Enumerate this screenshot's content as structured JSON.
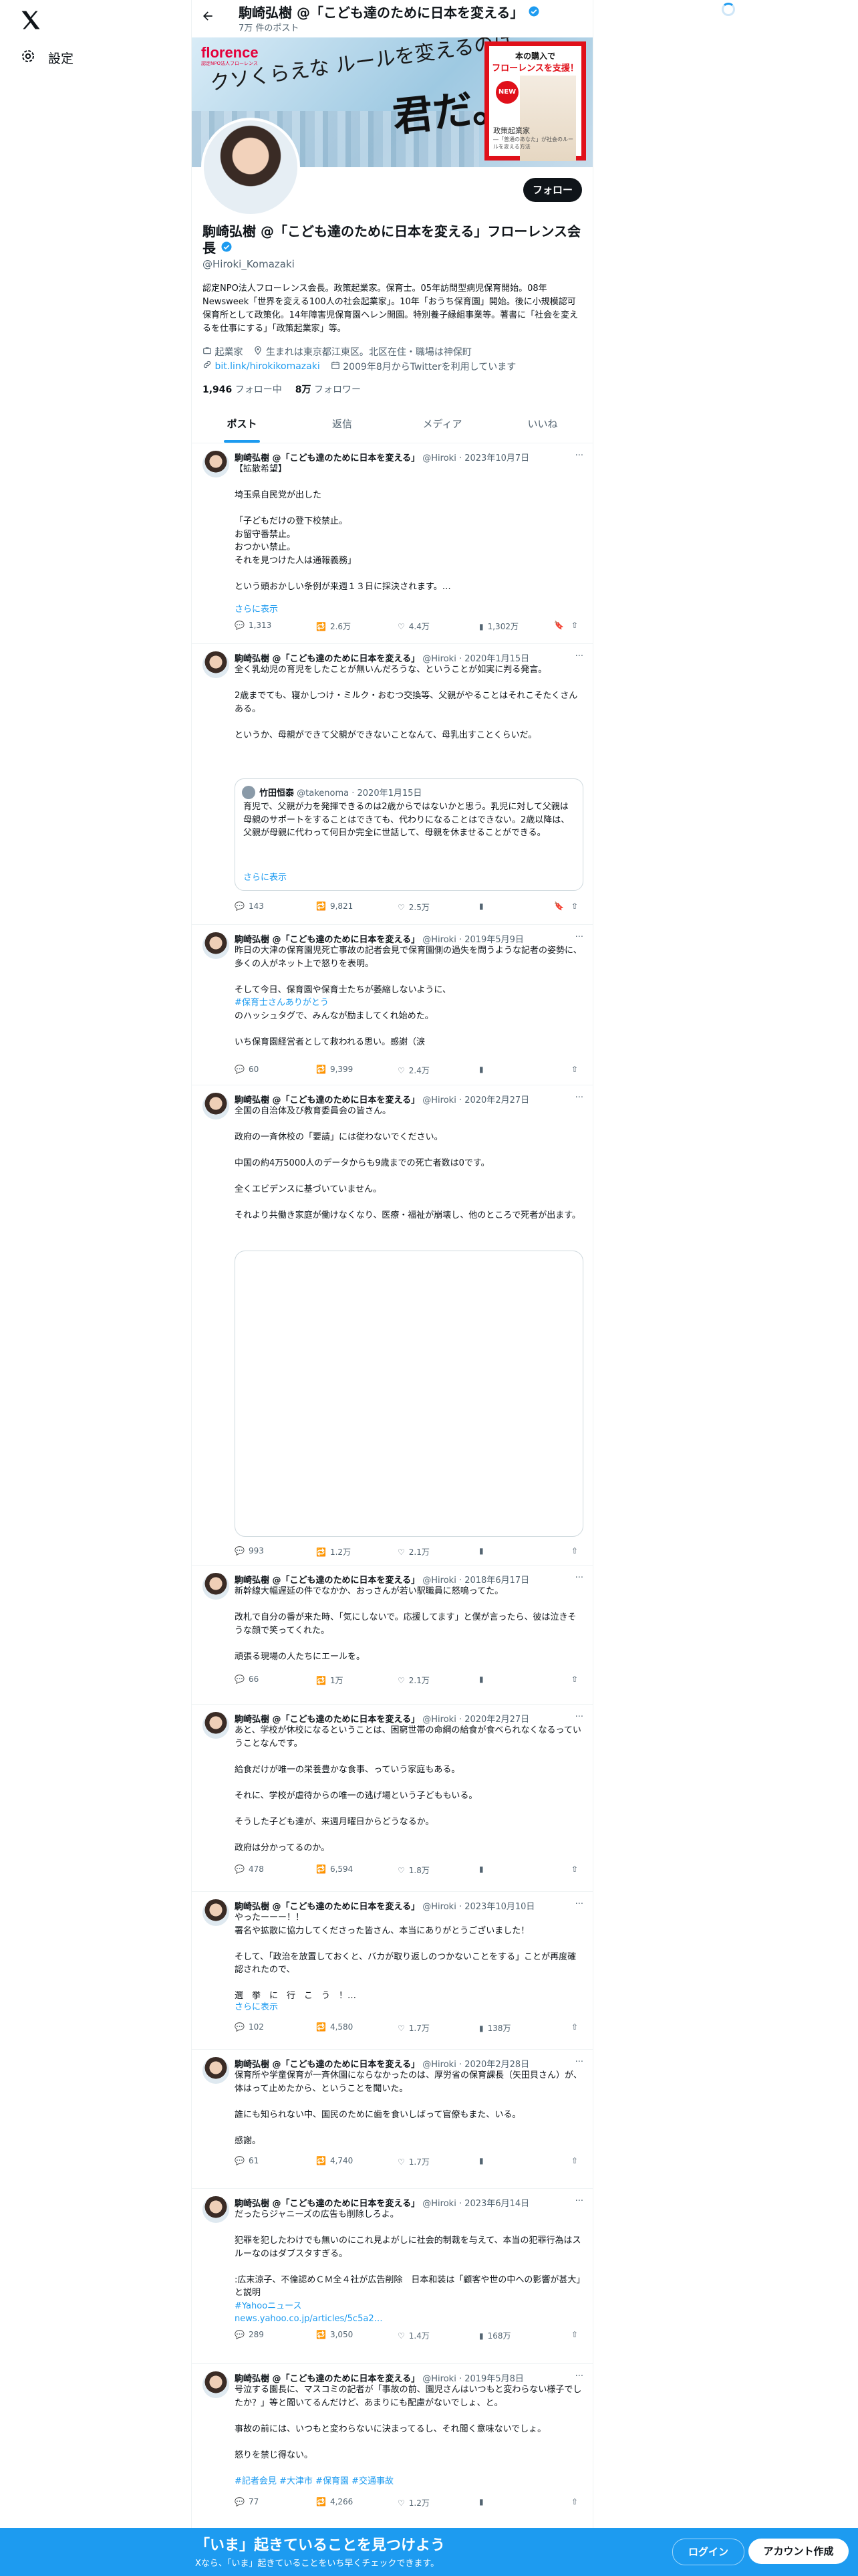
{
  "nav": {
    "settings_label": "設定"
  },
  "profile": {
    "title": "駒崎弘樹 @「こども達のために日本を変える」",
    "post_count": "7万 件のポスト",
    "follow_label": "フォロー",
    "display_name": "駒崎弘樹 @「こども達のために日本を変える」フローレンス会長",
    "handle": "@Hiroki_Komazaki",
    "bio": "認定NPO法人フローレンス会長。政策起業家。保育士。05年訪問型病児保育開始。08年Newsweek「世界を変える100人の社会起業家」。10年「おうち保育園」開始。後に小規模認可保育所として政策化。14年障害児保育園ヘレン開園。特別養子縁組事業等。著書に「社会を変えるを仕事にする」「政策起業家」等。",
    "occupation": "起業家",
    "born": "生まれは東京都江東区。北区在住・職場は神保町",
    "link": "bit.link/hirokikomazaki",
    "joined": "2009年8月からTwitterを利用しています",
    "following_count": "1,946",
    "following_label": "フォロー中",
    "followers_count": "8万",
    "followers_label": "フォロワー"
  },
  "banner": {
    "brand": "florence",
    "brand_sub": "認定NPO法人フローレンス",
    "copy": "クソくらえな ルールを変えるのは、",
    "copy_big": "君だ。",
    "ad_line1": "本の購入で",
    "ad_line2": "フローレンスを支援！",
    "ad_new": "NEW",
    "ad_book_title": "政策起業家",
    "ad_book_sub": "―「普通のあなた」が社会のルールを変える方法"
  },
  "tabs": [
    "ポスト",
    "返信",
    "メディア",
    "いいね"
  ],
  "tweets": [
    {
      "name": "駒崎弘樹 @「こども達のために日本を変える」",
      "handle": "@Hiroki",
      "date": "2023年10月7日",
      "text": "【拡散希望】\n\n埼玉県自民党が出した\n\n「子どもだけの登下校禁止。\nお留守番禁止。\nおつかい禁止。\nそれを見つけた人は通報義務」\n\nという頭おかしい条例が来週１３日に採決されます。…",
      "show_more": "さらに表示",
      "replies": "1,313",
      "reposts": "2.6万",
      "likes": "4.4万",
      "views": "1,302万"
    },
    {
      "name": "駒崎弘樹 @「こども達のために日本を変える」",
      "handle": "@Hiroki",
      "date": "2020年1月15日",
      "text": "全く乳幼児の育児をしたことが無いんだろうな、ということが如実に判る発言。\n\n2歳までても、寝かしつけ・ミルク・おむつ交換等、父親がやることはそれこそたくさんある。\n\nというか、母親ができて父親ができないことなんて、母乳出すことくらいだ。",
      "quote": {
        "name": "竹田恒泰",
        "handle": "@takenoma",
        "date": "2020年1月15日",
        "text": "育児で、父親が力を発揮できるのは2歳からではないかと思う。乳児に対して父親は母親のサポートをすることはできても、代わりになることはできない。2歳以降は、父親が母親に代わって何日か完全に世話して、母親を休ませることができる。",
        "show_more": "さらに表示"
      },
      "replies": "143",
      "reposts": "9,821",
      "likes": "2.5万"
    },
    {
      "name": "駒崎弘樹 @「こども達のために日本を変える」",
      "handle": "@Hiroki",
      "date": "2019年5月9日",
      "text": "昨日の大津の保育園児死亡事故の記者会見で保育園側の過失を問うような記者の姿勢に、多くの人がネット上で怒りを表明。\n\nそして今日、保育園や保育士たちが萎縮しないように、",
      "hashtag": "#保育士さんありがとう",
      "text_after": "のハッシュタグで、みんなが励ましてくれ始めた。\n\nいち保育園経営者として救われる思い。感謝（涙",
      "replies": "60",
      "reposts": "9,399",
      "likes": "2.4万"
    },
    {
      "name": "駒崎弘樹 @「こども達のために日本を変える」",
      "handle": "@Hiroki",
      "date": "2020年2月27日",
      "text": "全国の自治体及び教育委員会の皆さん。\n\n政府の一斉休校の「要請」には従わないでください。\n\n中国の約4万5000人のデータからも9歳までの死亡者数は0です。\n\n全くエビデンスに基づいていません。\n\nそれより共働き家庭が働けなくなり、医療・福祉が崩壊し、他のところで死者が出ます。",
      "replies": "993",
      "reposts": "1.2万",
      "likes": "2.1万"
    },
    {
      "name": "駒崎弘樹 @「こども達のために日本を変える」",
      "handle": "@Hiroki",
      "date": "2018年6月17日",
      "text": "新幹線大幅遅延の件でなかか、おっさんが若い駅職員に怒鳴ってた。\n\n改札で自分の番が来た時、「気にしないで。応援してます」と僕が言ったら、彼は泣きそうな顔で笑ってくれた。\n\n頑張る現場の人たちにエールを。",
      "replies": "66",
      "reposts": "1万",
      "likes": "2.1万"
    },
    {
      "name": "駒崎弘樹 @「こども達のために日本を変える」",
      "handle": "@Hiroki",
      "date": "2020年2月27日",
      "text": "あと、学校が休校になるということは、困窮世帯の命綱の給食が食べられなくなるっていうことなんです。\n\n給食だけが唯一の栄養豊かな食事、っていう家庭もある。\n\nそれに、学校が虐待からの唯一の逃げ場という子どももいる。\n\nそうした子ども達が、来週月曜日からどうなるか。\n\n政府は分かってるのか。",
      "replies": "478",
      "reposts": "6,594",
      "likes": "1.8万"
    },
    {
      "name": "駒崎弘樹 @「こども達のために日本を変える」",
      "handle": "@Hiroki",
      "date": "2023年10月10日",
      "text": "やったーーー！！\n署名や拡散に協力してくださった皆さん、本当にありがとうございました！\n\nそして、「政治を放置しておくと、バカが取り返しのつかないことをする」ことが再度確認されたので、\n\n選　挙　に　行　こ　う　！…",
      "show_more": "さらに表示",
      "replies": "102",
      "reposts": "4,580",
      "likes": "1.7万",
      "views": "138万"
    },
    {
      "name": "駒崎弘樹 @「こども達のために日本を変える」",
      "handle": "@Hiroki",
      "date": "2020年2月28日",
      "text": "保育所や学童保育が一斉休園にならなかったのは、厚労省の保育課長（矢田貝さん）が、体はって止めたから、ということを聞いた。\n\n誰にも知られない中、国民のために歯を食いしばって官僚もまた、いる。\n\n感謝。",
      "replies": "61",
      "reposts": "4,740",
      "likes": "1.7万"
    },
    {
      "name": "駒崎弘樹 @「こども達のために日本を変える」",
      "handle": "@Hiroki",
      "date": "2023年6月14日",
      "text": "だったらジャニーズの広告も削除しろよ。\n\n犯罪を犯したわけでも無いのにこれ見よがしに社会的制裁を与えて、本当の犯罪行為はスルーなのはダブスタすぎる。\n\n:広末涼子、不倫認めＣＭ全４社が広告削除　日本和装は「顧客や世の中への影響が甚大」と説明",
      "hashtag": "#Yahooニュース",
      "link": "news.yahoo.co.jp/articles/5c5a2…",
      "replies": "289",
      "reposts": "3,050",
      "likes": "1.4万",
      "views": "168万"
    },
    {
      "name": "駒崎弘樹 @「こども達のために日本を変える」",
      "handle": "@Hiroki",
      "date": "2019年5月8日",
      "text": "号泣する園長に、マスコミの記者が「事故の前、園児さんはいつもと変わらない様子でしたか？」等と聞いてるんだけど、あまりにも配慮がないでしょ、と。\n\n事故の前には、いつもと変わらないに決まってるし、それ聞く意味ないでしょ。\n\n怒りを禁じ得ない。",
      "hashtag": "#記者会見 #大津市 #保育園 #交通事故",
      "replies": "77",
      "reposts": "4,266",
      "likes": "1.2万"
    }
  ],
  "footer": {
    "title": "「いま」起きていることを見つけよう",
    "subtitle": "Xなら、「いま」起きていることをいち早くチェックできます。",
    "login_label": "ログイン",
    "signup_label": "アカウント作成"
  },
  "colors": {
    "accent": "#1d9bf0",
    "text": "#0f1419",
    "muted": "#536471",
    "ad_red": "#e0101a"
  }
}
